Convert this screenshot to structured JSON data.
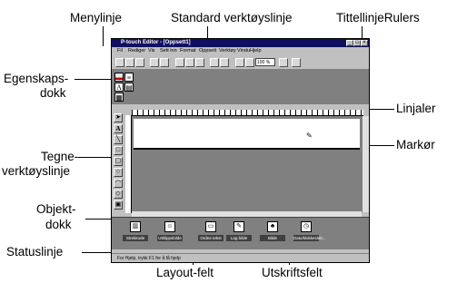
{
  "callouts": {
    "menylinje": "Menylinje",
    "standard_toolbar": "Standard verktøyslinje",
    "tittellinje": "TittellinjeRulers",
    "egenskaps_1": "Egenskaps-",
    "egenskaps_2": "dokk",
    "linjaler": "Linjaler",
    "markor": "Markør",
    "tegne_1": "Tegne-",
    "tegne_2": "verktøyslinje",
    "objekt_1": "Objekt-",
    "objekt_2": "dokk",
    "statuslinje": "Statuslinje",
    "layout_felt": "Layout-felt",
    "utskriftsfelt": "Utskriftsfelt"
  },
  "window": {
    "title": "P-touch Editor - [Oppsett1]",
    "menu": [
      "Fil",
      "Rediger",
      "Vis",
      "Sett inn",
      "Format",
      "Oppsett",
      "Verktøy",
      "Vindu",
      "Hjelp"
    ],
    "zoom": "100 %",
    "status": "For Hjelp, trykk F1 for å få hjelp",
    "objects": [
      "Strekkode",
      "Utklippsbilde",
      "Ordne tekst",
      "Lag bilde",
      "Bilde",
      "Dato/klokkeslett..."
    ]
  },
  "icons": [
    "cursor-icon",
    "text-icon",
    "line-icon",
    "rectangle-icon",
    "rounded-rect-icon",
    "ellipse-icon",
    "arc-icon",
    "polygon-icon",
    "frame-icon",
    "barcode-icon",
    "clipart-icon",
    "picture-icon",
    "datetime-icon"
  ]
}
